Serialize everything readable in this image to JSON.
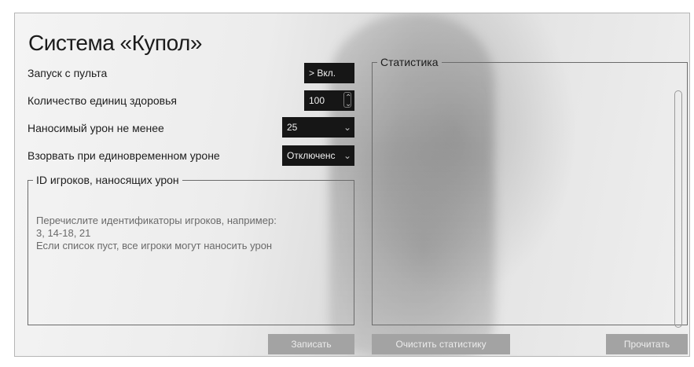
{
  "app": {
    "title": "Система «Купол»"
  },
  "settings": {
    "launch": {
      "label": "Запуск с пульта",
      "button": "> Вкл."
    },
    "health": {
      "label": "Количество единиц здоровья",
      "value": "100"
    },
    "damage": {
      "label": "Наносимый урон не менее",
      "value": "25"
    },
    "explode": {
      "label": "Взорвать при единовременном уроне",
      "value": "Отключенс"
    }
  },
  "ids_group": {
    "legend": "ID игроков, наносящих урон",
    "placeholder": "Перечислите идентификаторы игроков, например:\n3, 14-18, 21\nЕсли список пуст, все игроки могут наносить урон"
  },
  "stats_group": {
    "legend": "Статистика"
  },
  "buttons": {
    "write": "Записать",
    "clear": "Очистить статистику",
    "read": "Прочитать"
  },
  "icons": {
    "spinner": "spinner-arrows-icon",
    "dropdown": "chevron-down-icon"
  }
}
